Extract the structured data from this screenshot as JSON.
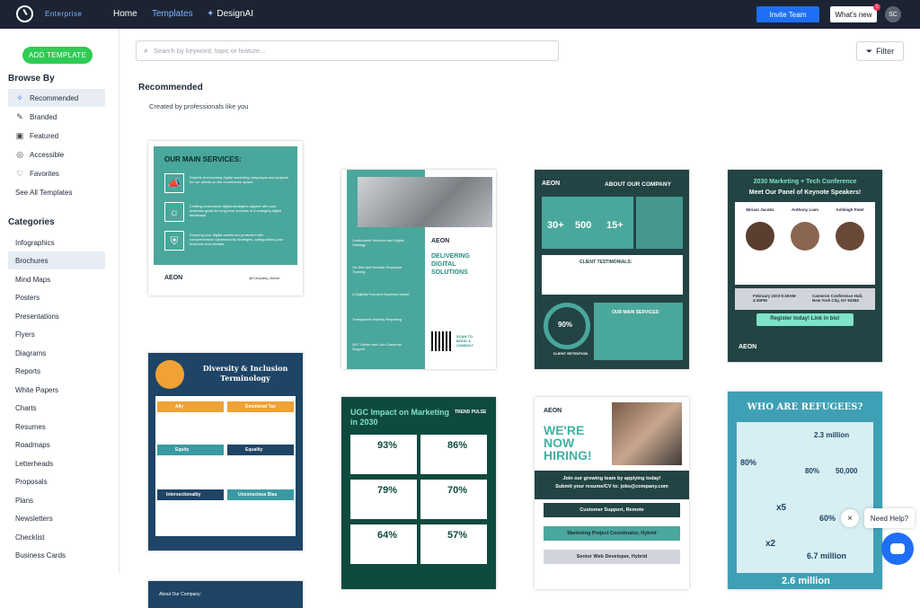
{
  "topbar": {
    "edition": "Enterprise",
    "nav": [
      "Home",
      "Templates",
      "DesignAI"
    ],
    "invite": "Invite Team",
    "whats_new": "What's new",
    "badge": "1",
    "avatar": "SC"
  },
  "sidebar": {
    "add_template": "ADD TEMPLATE",
    "browse_title": "Browse By",
    "browse": [
      {
        "label": "Recommended",
        "icon": "sparkle-icon"
      },
      {
        "label": "Branded",
        "icon": "brush-icon"
      },
      {
        "label": "Featured",
        "icon": "calendar-icon"
      },
      {
        "label": "Accessible",
        "icon": "accessibility-icon"
      },
      {
        "label": "Favorites",
        "icon": "heart-icon"
      },
      {
        "label": "See All Templates",
        "icon": ""
      }
    ],
    "categories_title": "Categories",
    "categories": [
      "Infographics",
      "Brochures",
      "Mind Maps",
      "Posters",
      "Presentations",
      "Flyers",
      "Diagrams",
      "Reports",
      "White Papers",
      "Charts",
      "Resumes",
      "Roadmaps",
      "Letterheads",
      "Proposals",
      "Plans",
      "Newsletters",
      "Checklist",
      "Business Cards"
    ]
  },
  "main": {
    "search_placeholder": "Search by keyword, topic or feature...",
    "filter": "Filter",
    "heading": "Recommended",
    "subheading": "Created by professionals like you"
  },
  "cards": {
    "c1": {
      "title": "OUR MAIN SERVICES:",
      "items": [
        "Experts at executing digital marketing campaigns and projects for our clients on the ecommerce space.",
        "Crafting customized digital strategies aligned with your business goals for long-term success in a changing digital landscape.",
        "Ensuring your digital assets are protected with comprehensive cybersecurity strategies, safeguarding your business from threats."
      ],
      "brand": "AEON",
      "handle": "@Company_Name"
    },
    "c2": {
      "brand": "AEON",
      "title": "DELIVERING DIGITAL SOLUTIONS",
      "items": [
        "Customized Services and Digital Strategy",
        "On-Site and Remote Employee Training",
        "A Digitally Focused Business Model",
        "Transparent Monthly Reporting",
        "24/7 Online and Live Customer Support"
      ],
      "scan": "SCAN TO BOOK A CONSULT"
    },
    "c3": {
      "brand": "AEON",
      "title": "ABOUT OUR COMPANY",
      "stats": [
        "30+",
        "500",
        "15+"
      ],
      "testimonials": "CLIENT TESTIMONIALS:",
      "retention": "90%",
      "retention_label": "CLIENT RETENTION",
      "services": "OUR MAIN SERVICES:"
    },
    "c4": {
      "title": "2030 Marketing + Tech Conference",
      "subtitle": "Meet Our Panel of Keynote Speakers!",
      "speakers": [
        "Miriam Jacobs",
        "Anthony Liam",
        "Ashleigh Patel"
      ],
      "date": "February 23rd 9:30AM-4:30PM",
      "place": "Cameron Conference Hall, New York City, NY 93382",
      "cta": "Register today! Link in bio!",
      "brand": "AEON"
    },
    "c5": {
      "title": "Diversity & Inclusion Terminology",
      "terms": [
        "Ally",
        "Emotional Tax",
        "Equity",
        "Equality",
        "Intersectionality",
        "Unconscious Bias"
      ]
    },
    "c6": {
      "title": "UGC Impact on Marketing in 2030",
      "brand": "TREND PULSE",
      "stats": [
        "93%",
        "86%",
        "79%",
        "70%",
        "64%",
        "57%"
      ]
    },
    "c7": {
      "brand": "AEON",
      "title": "WE'RE NOW HIRING!",
      "join": "Join our growing team by applying today!",
      "submit": "Submit your resume/CV to: jobs@company.com",
      "jobs": [
        "Customer Support, Remote",
        "Marketing Project Coordinator, Hybrid",
        "Senior Web Developer, Hybrid"
      ]
    },
    "c8": {
      "title": "WHO ARE REFUGEES?",
      "stats": [
        "2.3 million",
        "80%",
        "80%",
        "50,000",
        "x5",
        "60%",
        "x2",
        "6.7 million",
        "2.6 million"
      ]
    },
    "c9": {
      "title": "About Our Company:"
    }
  },
  "chat": {
    "label": "Need Help?",
    "close": "×"
  },
  "colors": {
    "topbar": "#1c2433",
    "accent": "#1e6ff5",
    "green": "#2ecc55",
    "teal": "#4aa79b",
    "dark_teal": "#0f4a47"
  }
}
